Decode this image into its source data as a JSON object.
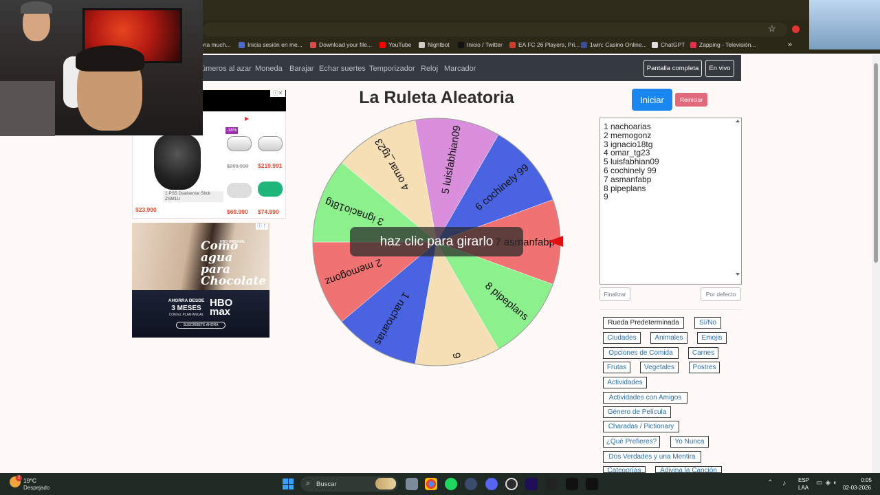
{
  "bookmarks": [
    {
      "label": "ona much...",
      "color": "#2b2818"
    },
    {
      "label": "Inicia sesión en me...",
      "color": "#4a6bd6"
    },
    {
      "label": "Download your file...",
      "color": "#e24b4b"
    },
    {
      "label": "YouTube",
      "color": "#ff0000"
    },
    {
      "label": "Nightbot",
      "color": "#cccccc"
    },
    {
      "label": "Inicio / Twitter",
      "color": "#111111"
    },
    {
      "label": "EA FC 26 Players, Pri...",
      "color": "#d43b2b"
    },
    {
      "label": "1win: Casino Online...",
      "color": "#3b4e9e"
    },
    {
      "label": "ChatGPT",
      "color": "#dddddd"
    },
    {
      "label": "Zapping - Televisión...",
      "color": "#e0324f"
    }
  ],
  "nav": {
    "links": [
      "úmeros al azar",
      "Moneda",
      "Barajar",
      "Echar suertes",
      "Temporizador",
      "Reloj",
      "Marcador"
    ],
    "fullscreen": "Pantalla completa",
    "live": "En vivo"
  },
  "ad1": {
    "main_price": "$23.990",
    "product_label": "1 PS5 Dualsense Stick ZSM1U",
    "discount": "-18%",
    "old_price": "$269.990",
    "price2": "$219.991",
    "price3": "$69.990",
    "price4": "$74.990"
  },
  "ad2": {
    "brand_small": "HBO ORIGINAL",
    "title": "Como agua para Chocolate",
    "desde": "AHORRA DESDE",
    "meses": "3 MESES",
    "plan": "CON EL PLAN ANUAL",
    "logo": "HBO max",
    "cta": "SUSCRÍBETE AHORA"
  },
  "page": {
    "title": "La Ruleta Aleatoria",
    "tooltip": "haz clic para girarlo",
    "start": "Iniciar",
    "reset": "Reiniciar",
    "finish": "Finalizar",
    "default": "Por defecto"
  },
  "names": [
    "1 nachoarias",
    "2 memogonz",
    "3 ignacio18tg",
    "4 omar_tg23",
    "5 luisfabhian09",
    "6 cochinely 99",
    "7 asmanfabp",
    "8 pipeplans",
    "9"
  ],
  "wheel": {
    "segments": [
      {
        "label": "7 asmanfabp",
        "color": "#f07272"
      },
      {
        "label": "8 pipeplans",
        "color": "#8cf08c"
      },
      {
        "label": "9",
        "color": "#f6deb5"
      },
      {
        "label": "1 nachoarias",
        "color": "#4a63e0"
      },
      {
        "label": "2 memogonz",
        "color": "#f07272"
      },
      {
        "label": "3 ignacio18tg",
        "color": "#8cf08c"
      },
      {
        "label": "4 omar_tg23",
        "color": "#f6deb5"
      },
      {
        "label": "5 luisfabhian09",
        "color": "#d98fdc"
      },
      {
        "label": "6 cochinely 99",
        "color": "#4a63e0"
      }
    ]
  },
  "categories": [
    "Rueda Predeterminada",
    "Sí/No",
    "Ciudades",
    "Animales",
    "Emojis",
    "Opciones de Comida",
    "Carnes",
    "Frutas",
    "Vegetales",
    "Postres",
    "Actividades",
    "Actividades con Amigos",
    "Género de Película",
    "Charadas / Pictionary",
    "¿Qué Prefieres?",
    "Yo Nunca",
    "Dos Verdades y una Mentira",
    "Categorías",
    "Adivina la Canción"
  ],
  "taskbar": {
    "temp": "19°C",
    "weather": "Despejado",
    "weather_badge": "2",
    "search": "Buscar",
    "lang1": "ESP",
    "lang2": "LAA",
    "time": "0:05",
    "date": "02-03-2026"
  }
}
